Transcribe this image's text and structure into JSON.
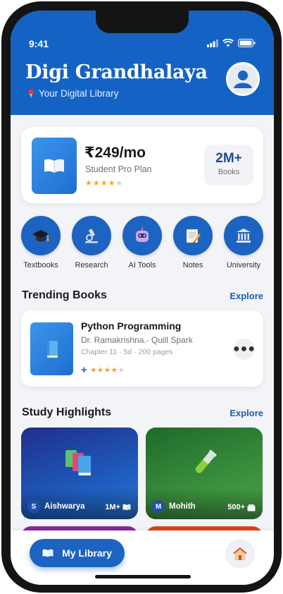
{
  "status": {
    "time": "9:41"
  },
  "header": {
    "title": "Digi Grandhalaya",
    "subtitle": "Your Digital Library"
  },
  "plan": {
    "price": "₹249/mo",
    "name": "Student Pro Plan",
    "rating": 4,
    "rating_max": 5,
    "books_count": "2M+",
    "books_label": "Books"
  },
  "categories": [
    {
      "label": "Textbooks",
      "icon": "graduation-cap-icon"
    },
    {
      "label": "Research",
      "icon": "microscope-icon"
    },
    {
      "label": "AI Tools",
      "icon": "robot-icon"
    },
    {
      "label": "Notes",
      "icon": "notepad-icon"
    },
    {
      "label": "University",
      "icon": "university-icon"
    }
  ],
  "trending": {
    "title": "Trending Books",
    "link": "Explore",
    "book": {
      "title": "Python Programming",
      "authors": "Dr. Ramakrishna.· Quill Spark",
      "meta": "Chapter 11 · 5d · 200 pages",
      "rating": 4,
      "rating_max": 5
    }
  },
  "highlights": {
    "title": "Study Highlights",
    "link": "Explore",
    "cards": [
      {
        "initial": "S",
        "name": "Aishwarya",
        "count": "1M+",
        "count_icon": "book-icon",
        "art": "books-icon"
      },
      {
        "initial": "M",
        "name": "Mohith",
        "count": "500+",
        "count_icon": "documents-icon",
        "art": "test-tube-icon"
      }
    ]
  },
  "nav": {
    "library_label": "My Library",
    "home_icon": "home-icon"
  },
  "colors": {
    "primary": "#1d63c1",
    "header": "#1463c4",
    "star": "#f0a830"
  }
}
